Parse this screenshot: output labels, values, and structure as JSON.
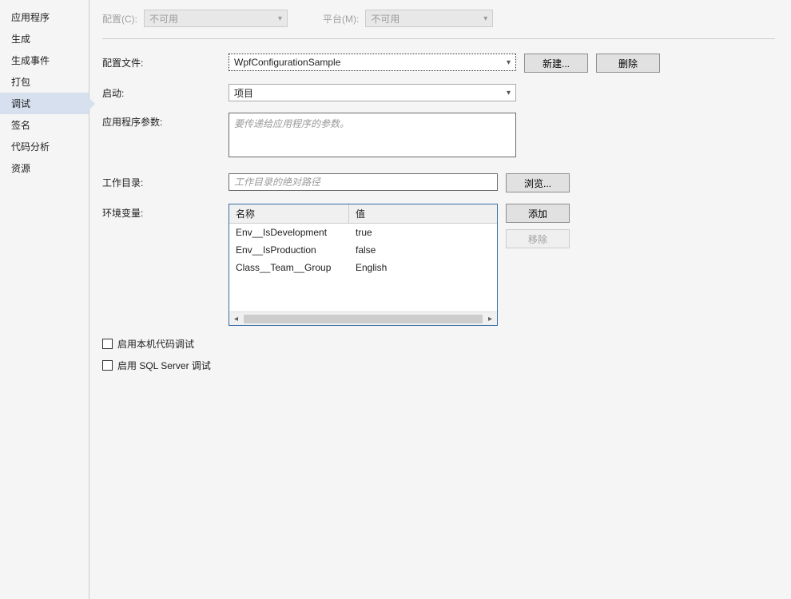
{
  "sidebar": {
    "items": [
      {
        "label": "应用程序"
      },
      {
        "label": "生成"
      },
      {
        "label": "生成事件"
      },
      {
        "label": "打包"
      },
      {
        "label": "调试"
      },
      {
        "label": "签名"
      },
      {
        "label": "代码分析"
      },
      {
        "label": "资源"
      }
    ],
    "active_index": 4
  },
  "top": {
    "config_label": "配置(C):",
    "config_value": "不可用",
    "platform_label": "平台(M):",
    "platform_value": "不可用"
  },
  "form": {
    "profile_label": "配置文件:",
    "profile_value": "WpfConfigurationSample",
    "new_btn": "新建...",
    "delete_btn": "删除",
    "launch_label": "启动:",
    "launch_value": "项目",
    "args_label": "应用程序参数:",
    "args_placeholder": "要传递给应用程序的参数。",
    "workdir_label": "工作目录:",
    "workdir_placeholder": "工作目录的绝对路径",
    "browse_btn": "浏览...",
    "env_label": "环境变量:",
    "env_head_name": "名称",
    "env_head_value": "值",
    "env_rows": [
      {
        "name": "Env__IsDevelopment",
        "value": "true"
      },
      {
        "name": "Env__IsProduction",
        "value": "false"
      },
      {
        "name": "Class__Team__Group",
        "value": "English"
      }
    ],
    "add_btn": "添加",
    "remove_btn": "移除",
    "native_debug_label": "启用本机代码调试",
    "sql_debug_label": "启用 SQL Server 调试"
  }
}
